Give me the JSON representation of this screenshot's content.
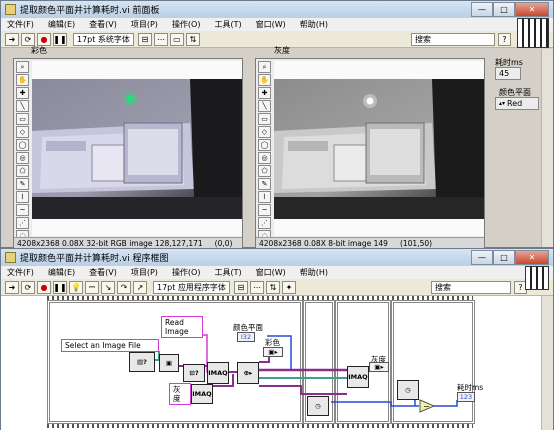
{
  "front_panel": {
    "title": "提取颜色平面并计算耗时.vi 前面板",
    "menu": [
      "文件(F)",
      "编辑(E)",
      "查看(V)",
      "项目(P)",
      "操作(O)",
      "工具(T)",
      "窗口(W)",
      "帮助(H)"
    ],
    "font_label": "17pt 系统字体",
    "search_placeholder": "搜索",
    "display_color": {
      "label": "彩色",
      "status": "4208x2368 0.08X 32-bit RGB image 128,127,171",
      "coords": "(0,0)"
    },
    "display_gray": {
      "label": "灰度",
      "status": "4208x2368 0.08X 8-bit image 149",
      "coords": "(101,50)"
    },
    "elapsed": {
      "label": "耗时ms",
      "value": "45"
    },
    "color_plane": {
      "label": "颜色平面",
      "value": "Red"
    }
  },
  "block_diagram": {
    "title": "提取颜色平面并计算耗时.vi 程序框图",
    "menu": [
      "文件(F)",
      "编辑(E)",
      "查看(V)",
      "项目(P)",
      "操作(O)",
      "工具(T)",
      "窗口(W)",
      "帮助(H)"
    ],
    "font_label": "17pt 应用程序字体",
    "search_placeholder": "搜索",
    "const_select": "Select an Image File",
    "const_read": "Read\nImage",
    "const_gray": "灰度",
    "label_plane": "颜色平面",
    "plane_terminal": "I32",
    "label_color": "彩色",
    "label_gray": "灰度",
    "label_elapsed": "耗时ms",
    "imaq1": "IMAQ",
    "imaq2": "IMAQ",
    "imaq3": "IMAQ"
  },
  "window_buttons": {
    "minimize": "—",
    "maximize": "□",
    "close": "✕"
  },
  "colors": {
    "wire_image": "#8b2e8b",
    "wire_path": "#3aa38f",
    "wire_num": "#2a4bd1",
    "const_border": "#d63ad6"
  }
}
